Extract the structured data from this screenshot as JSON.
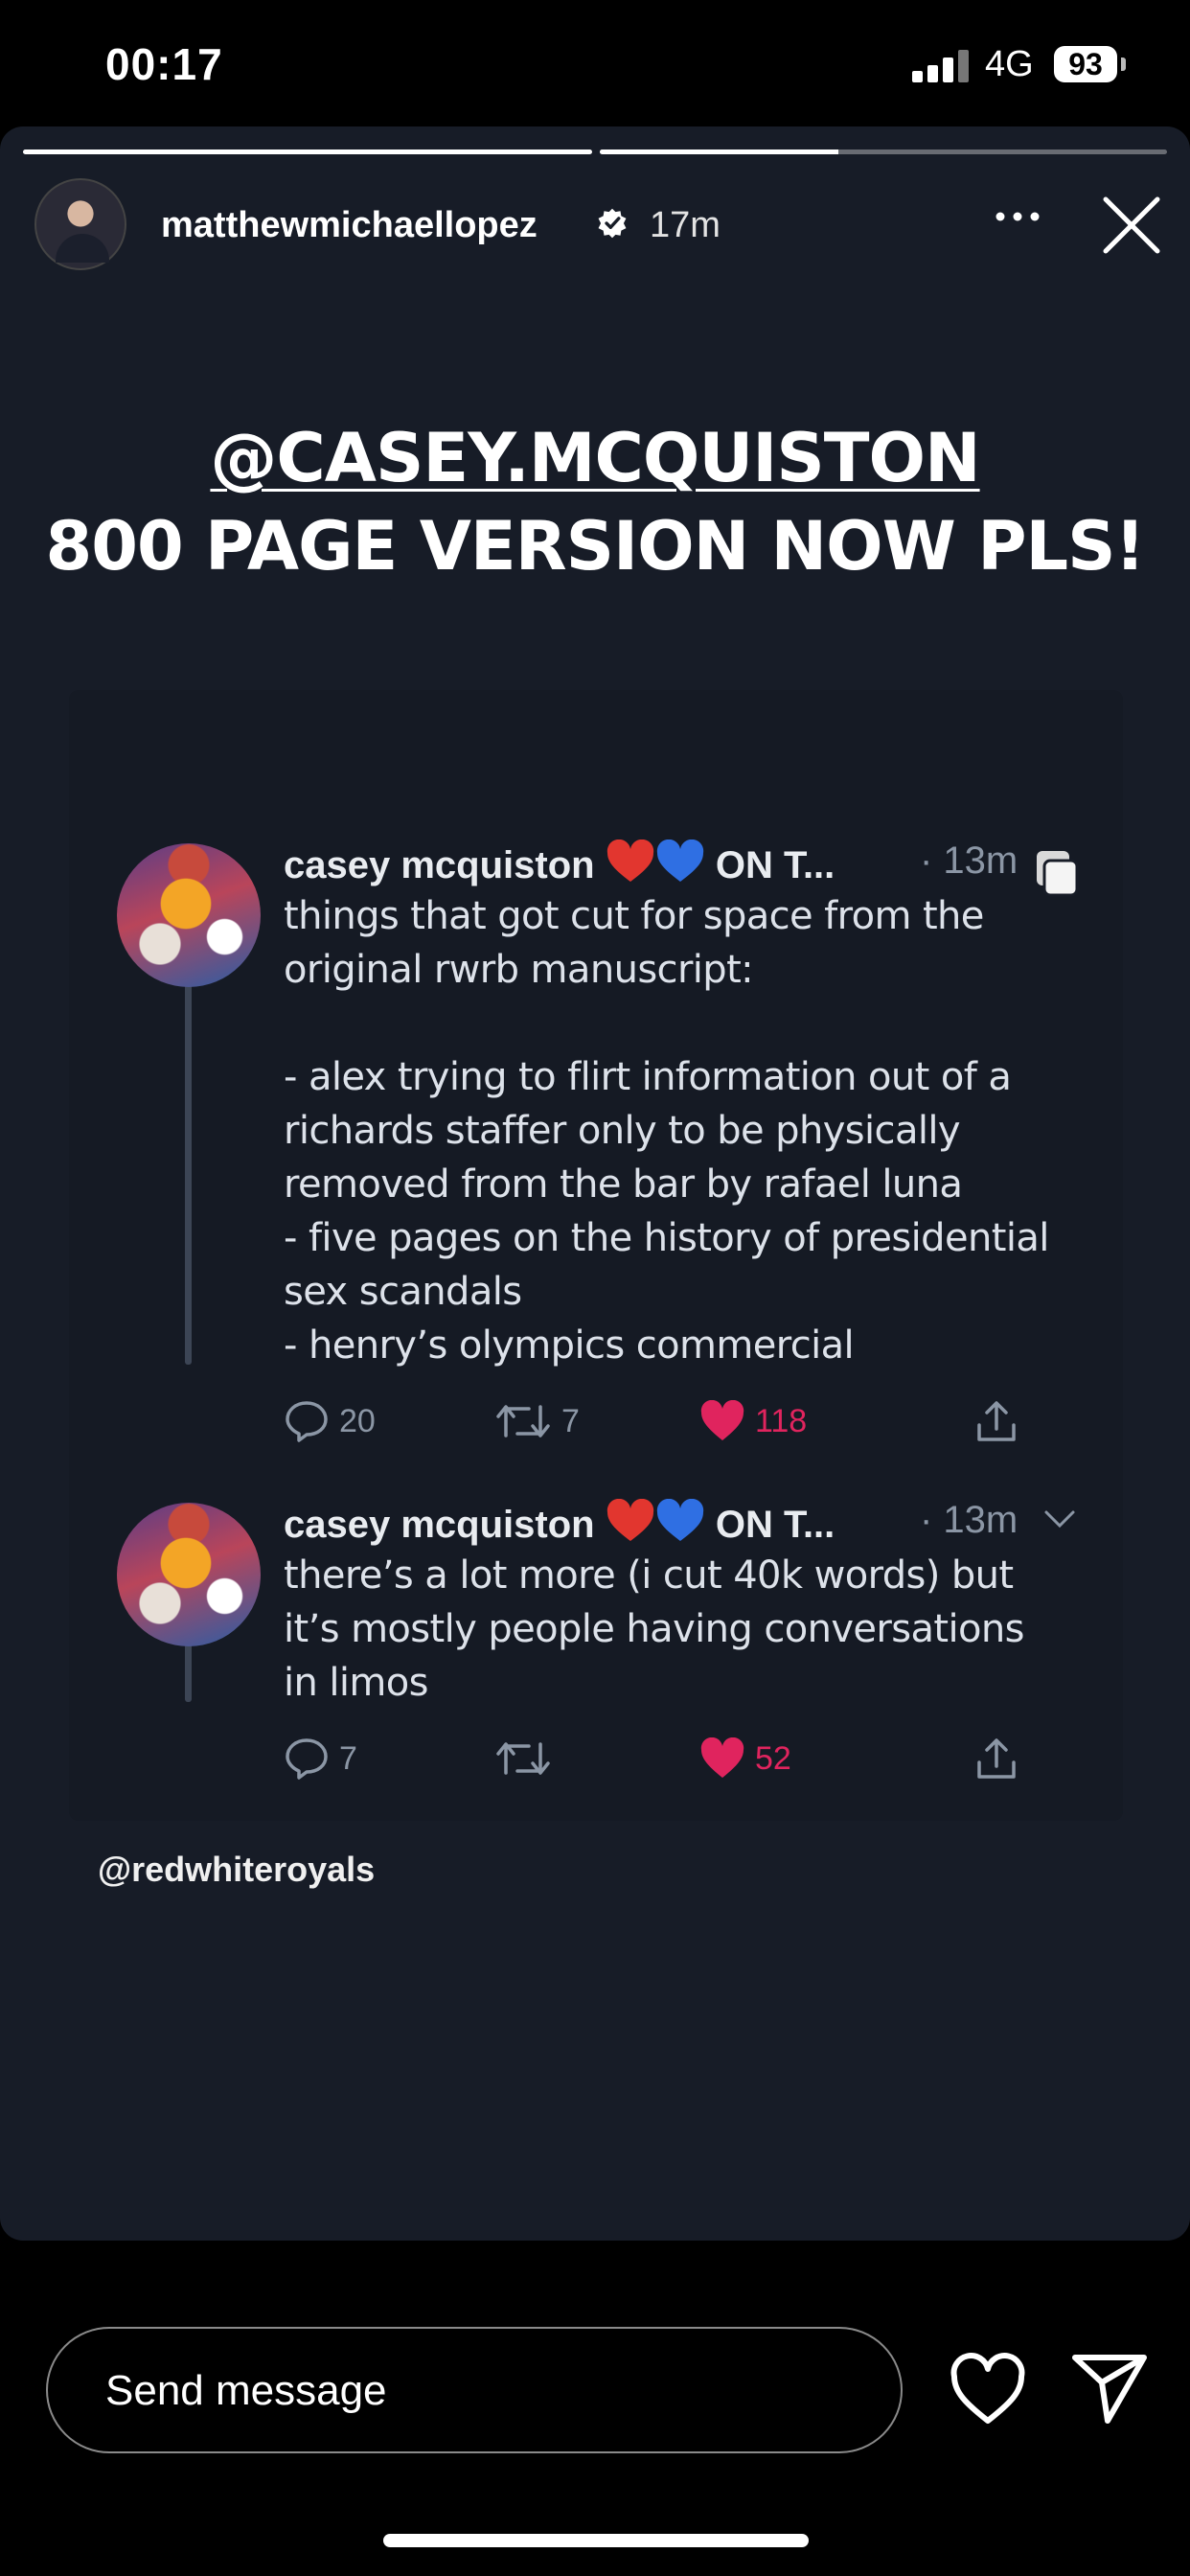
{
  "status_bar": {
    "time": "00:17",
    "network": "4G",
    "battery": "93"
  },
  "story": {
    "progress": [
      1.0,
      0.42
    ],
    "username": "matthewmichaellopez",
    "elapsed": "17m",
    "headline_line1": "@CASEY.MCQUISTON",
    "headline_line2": "800 PAGE VERSION NOW PLS!",
    "tweets": [
      {
        "name": "casey mcquiston",
        "name_suffix": "ON T...",
        "time": "· 13m",
        "lines": [
          "things that got cut for space from the",
          "original rwrb manuscript:",
          "",
          "- alex trying to flirt information out of a",
          "richards staffer only to be physically",
          "removed from the bar by rafael luna",
          "- five pages on the history of presidential",
          "sex scandals",
          "- henry’s olympics commercial"
        ],
        "replies": "20",
        "retweets": "7",
        "likes": "118"
      },
      {
        "name": "casey mcquiston",
        "name_suffix": "ON T...",
        "time": "· 13m",
        "lines": [
          "there’s a lot more (i cut 40k words) but",
          "it’s mostly people having conversations",
          "in limos"
        ],
        "replies": "7",
        "retweets": "",
        "likes": "52"
      }
    ],
    "source_tag": "@redwhiteroyals"
  },
  "message_bar": {
    "placeholder": "Send message"
  },
  "colors": {
    "background": "#171c27",
    "like": "#e0245e",
    "muted": "#8b96a5"
  }
}
